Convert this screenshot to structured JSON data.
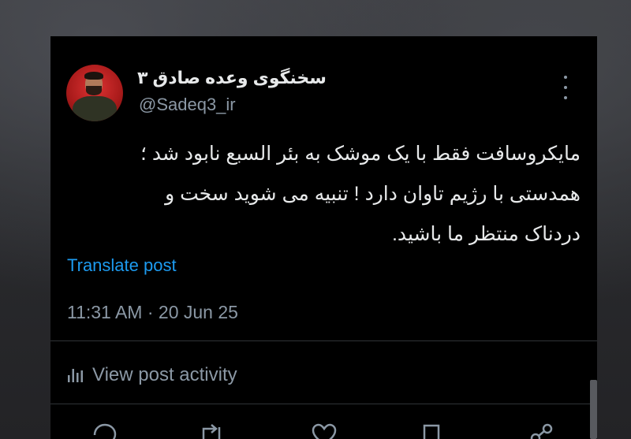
{
  "post": {
    "display_name": "سخنگوی وعده صادق ۳",
    "handle": "@Sadeq3_ir",
    "text_lines": [
      "مایکروسافت فقط با یک موشک به بئر السبع نابود شد ؛",
      "همدستی با رژیم تاوان دارد ! تنبیه می شوید سخت و",
      "دردناک منتظر ما باشید."
    ],
    "translate_label": "Translate post",
    "timestamp": "11:31 AM · 20 Jun 25",
    "activity_label": "View post activity"
  },
  "icons": {
    "more": "more-vertical-icon",
    "activity": "bar-chart-icon",
    "reply": "reply-icon",
    "repost": "repost-icon",
    "like": "heart-icon",
    "bookmark": "bookmark-icon",
    "share": "share-icon"
  },
  "colors": {
    "card_bg": "#000000",
    "text_primary": "#e7e9ea",
    "text_secondary": "#8b98a5",
    "link": "#1d9bf0",
    "divider": "#2f3336",
    "avatar_ring": "#c71f1f"
  }
}
